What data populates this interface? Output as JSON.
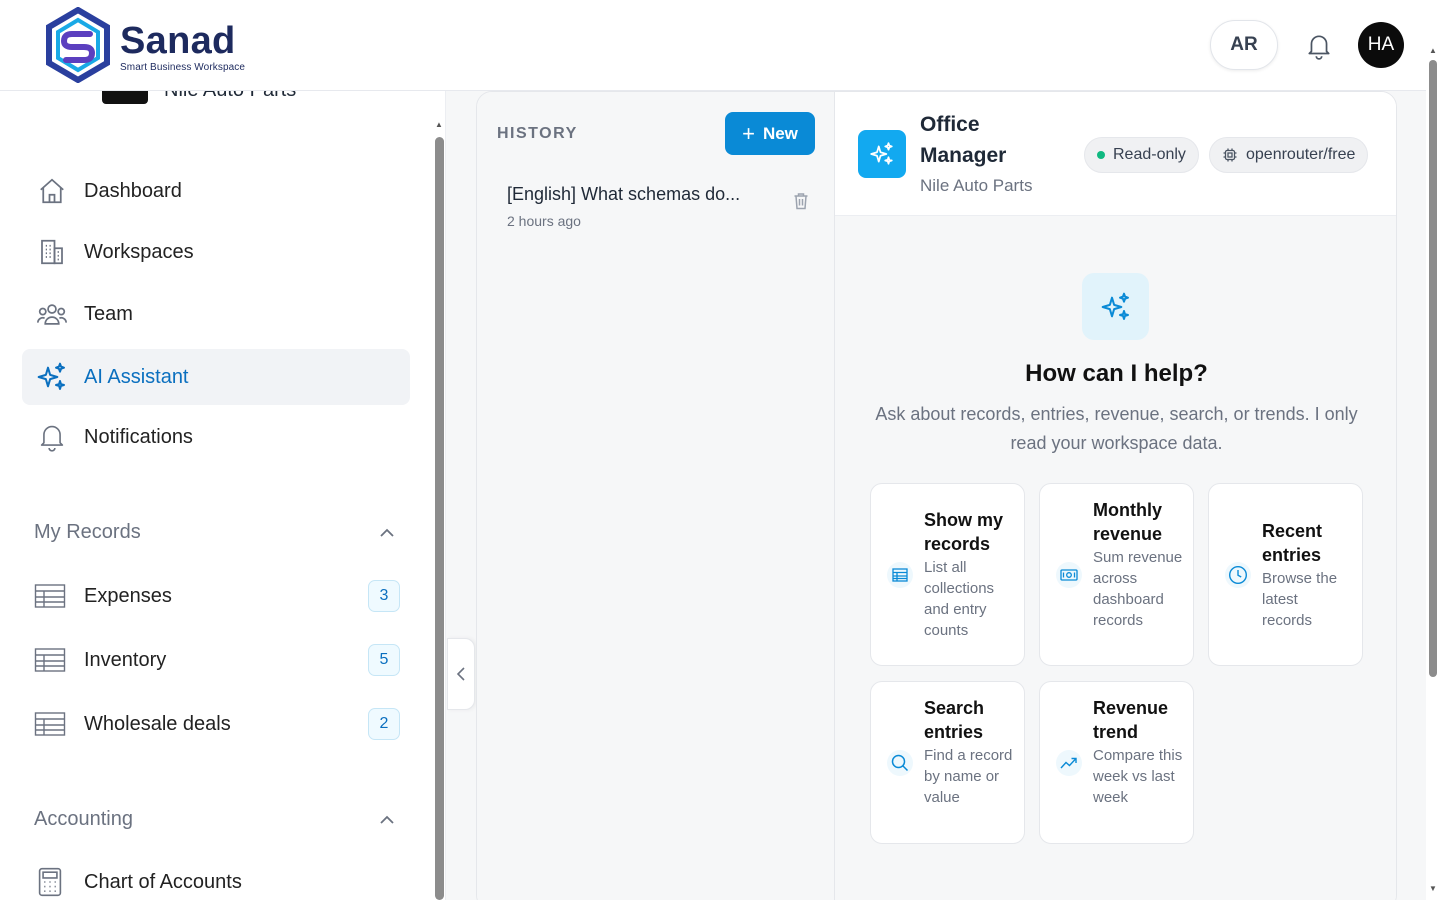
{
  "brand": {
    "name": "Sanad",
    "tagline": "Smart Business Workspace"
  },
  "header": {
    "lang_label": "AR",
    "avatar_initials": "HA"
  },
  "sidebar": {
    "workspace_name": "Nile Auto Parts",
    "nav": [
      {
        "label": "Dashboard",
        "icon": "home-icon"
      },
      {
        "label": "Workspaces",
        "icon": "building-icon"
      },
      {
        "label": "Team",
        "icon": "users-icon"
      },
      {
        "label": "AI Assistant",
        "icon": "sparkles-icon",
        "active": true
      },
      {
        "label": "Notifications",
        "icon": "bell-icon"
      }
    ],
    "my_records": {
      "title": "My Records",
      "items": [
        {
          "label": "Expenses",
          "count": "3"
        },
        {
          "label": "Inventory",
          "count": "5"
        },
        {
          "label": "Wholesale deals",
          "count": "2"
        }
      ]
    },
    "accounting": {
      "title": "Accounting",
      "items": [
        {
          "label": "Chart of Accounts"
        }
      ]
    }
  },
  "history": {
    "title": "HISTORY",
    "new_label": "New",
    "items": [
      {
        "title": "[English] What schemas do...",
        "time": "2 hours ago"
      }
    ]
  },
  "chat": {
    "agent_name": "Office Manager",
    "agent_workspace": "Nile Auto Parts",
    "mode_label": "Read-only",
    "model_label": "openrouter/free",
    "help_title": "How can I help?",
    "help_subtitle": "Ask about records, entries, revenue, search, or trends. I only read your workspace data.",
    "suggestions": [
      {
        "title": "Show my records",
        "desc": "List all collections and entry counts",
        "icon": "table-icon"
      },
      {
        "title": "Monthly revenue",
        "desc": "Sum revenue across dashboard records",
        "icon": "money-icon"
      },
      {
        "title": "Recent entries",
        "desc": "Browse the latest records",
        "icon": "clock-icon"
      },
      {
        "title": "Search entries",
        "desc": "Find a record by name or value",
        "icon": "search-icon"
      },
      {
        "title": "Revenue trend",
        "desc": "Compare this week vs last week",
        "icon": "trend-icon"
      }
    ]
  },
  "colors": {
    "accent": "#0a8ad6",
    "brand_navy": "#1d2a5e",
    "active_nav": "#0a6fbf",
    "status_green": "#10b981"
  }
}
